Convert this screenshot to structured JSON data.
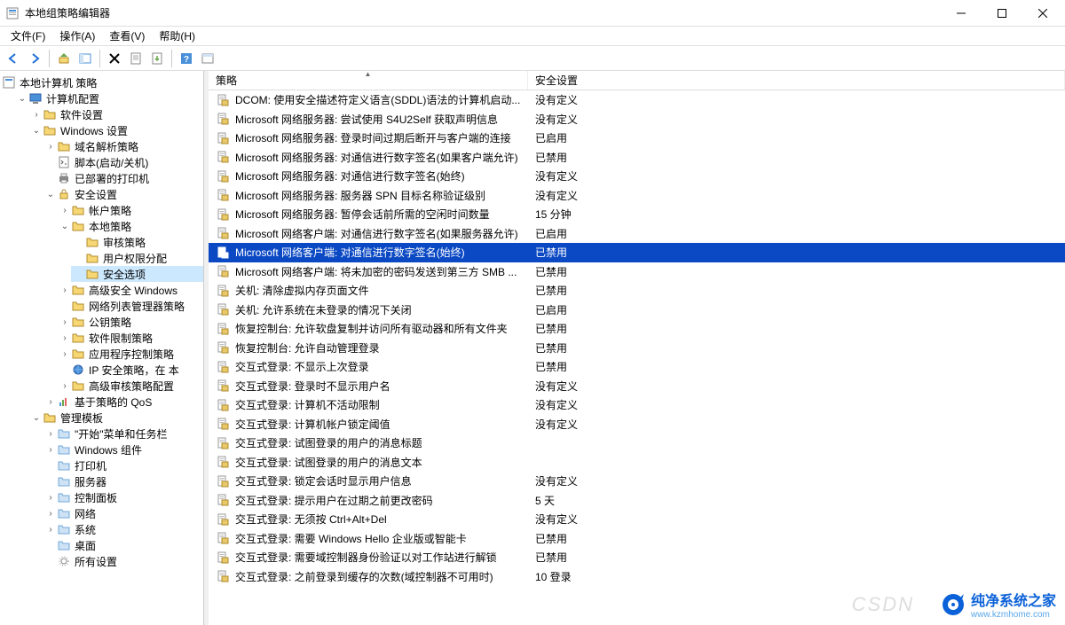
{
  "window": {
    "title": "本地组策略编辑器"
  },
  "menu": [
    "文件(F)",
    "操作(A)",
    "查看(V)",
    "帮助(H)"
  ],
  "tree": {
    "root": "本地计算机 策略",
    "computer_config": "计算机配置",
    "software_settings": "软件设置",
    "windows_settings": "Windows 设置",
    "name_resolution": "域名解析策略",
    "scripts": "脚本(启动/关机)",
    "deployed_printers": "已部署的打印机",
    "security_settings": "安全设置",
    "account_policies": "帐户策略",
    "local_policies": "本地策略",
    "audit_policy": "审核策略",
    "user_rights": "用户权限分配",
    "security_options": "安全选项",
    "advanced_windows": "高级安全 Windows",
    "network_list": "网络列表管理器策略",
    "public_key": "公钥策略",
    "software_restriction": "软件限制策略",
    "app_control": "应用程序控制策略",
    "ip_security": "IP 安全策略，在 本",
    "advanced_audit": "高级审核策略配置",
    "qos": "基于策略的 QoS",
    "admin_templates": "管理模板",
    "start_taskbar": "\"开始\"菜单和任务栏",
    "windows_components": "Windows 组件",
    "printers": "打印机",
    "servers": "服务器",
    "control_panel": "控制面板",
    "network": "网络",
    "system": "系统",
    "desktop": "桌面",
    "all_settings": "所有设置"
  },
  "columns": {
    "policy": "策略",
    "setting": "安全设置"
  },
  "selected_index": 8,
  "rows": [
    {
      "p": "DCOM: 使用安全描述符定义语言(SDDL)语法的计算机启动...",
      "s": "没有定义"
    },
    {
      "p": "Microsoft 网络服务器: 尝试使用 S4U2Self 获取声明信息",
      "s": "没有定义"
    },
    {
      "p": "Microsoft 网络服务器: 登录时间过期后断开与客户端的连接",
      "s": "已启用"
    },
    {
      "p": "Microsoft 网络服务器: 对通信进行数字签名(如果客户端允许)",
      "s": "已禁用"
    },
    {
      "p": "Microsoft 网络服务器: 对通信进行数字签名(始终)",
      "s": "没有定义"
    },
    {
      "p": "Microsoft 网络服务器: 服务器 SPN 目标名称验证级别",
      "s": "没有定义"
    },
    {
      "p": "Microsoft 网络服务器: 暂停会话前所需的空闲时间数量",
      "s": "15 分钟"
    },
    {
      "p": "Microsoft 网络客户端: 对通信进行数字签名(如果服务器允许)",
      "s": "已启用"
    },
    {
      "p": "Microsoft 网络客户端: 对通信进行数字签名(始终)",
      "s": "已禁用"
    },
    {
      "p": "Microsoft 网络客户端: 将未加密的密码发送到第三方 SMB ...",
      "s": "已禁用"
    },
    {
      "p": "关机: 清除虚拟内存页面文件",
      "s": "已禁用"
    },
    {
      "p": "关机: 允许系统在未登录的情况下关闭",
      "s": "已启用"
    },
    {
      "p": "恢复控制台: 允许软盘复制并访问所有驱动器和所有文件夹",
      "s": "已禁用"
    },
    {
      "p": "恢复控制台: 允许自动管理登录",
      "s": "已禁用"
    },
    {
      "p": "交互式登录: 不显示上次登录",
      "s": "已禁用"
    },
    {
      "p": "交互式登录: 登录时不显示用户名",
      "s": "没有定义"
    },
    {
      "p": "交互式登录: 计算机不活动限制",
      "s": "没有定义"
    },
    {
      "p": "交互式登录: 计算机帐户锁定阈值",
      "s": "没有定义"
    },
    {
      "p": "交互式登录: 试图登录的用户的消息标题",
      "s": ""
    },
    {
      "p": "交互式登录: 试图登录的用户的消息文本",
      "s": ""
    },
    {
      "p": "交互式登录: 锁定会话时显示用户信息",
      "s": "没有定义"
    },
    {
      "p": "交互式登录: 提示用户在过期之前更改密码",
      "s": "5 天"
    },
    {
      "p": "交互式登录: 无须按 Ctrl+Alt+Del",
      "s": "没有定义"
    },
    {
      "p": "交互式登录: 需要 Windows Hello 企业版或智能卡",
      "s": "已禁用"
    },
    {
      "p": "交互式登录: 需要域控制器身份验证以对工作站进行解锁",
      "s": "已禁用"
    },
    {
      "p": "交互式登录: 之前登录到缓存的次数(域控制器不可用时)",
      "s": "10 登录"
    }
  ],
  "watermark": {
    "brand": "纯净系统之家",
    "url": "www.kzmhome.com"
  },
  "csdn": "CSDN"
}
